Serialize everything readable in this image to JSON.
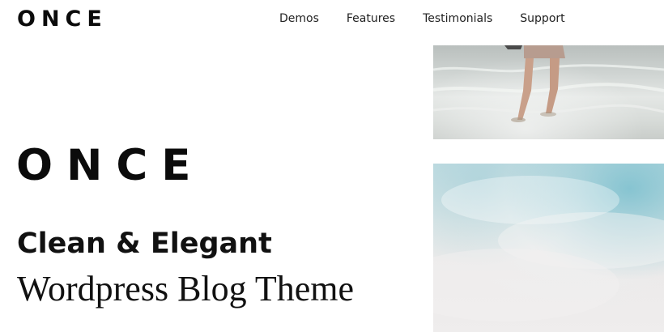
{
  "header": {
    "logo": "ONCE",
    "nav": [
      {
        "label": "Demos"
      },
      {
        "label": "Features"
      },
      {
        "label": "Testimonials"
      },
      {
        "label": "Support"
      }
    ]
  },
  "hero": {
    "logo": "ONCE",
    "tagline_line1": "Clean & Elegant",
    "tagline_line2": "Wordpress Blog Theme"
  },
  "images": {
    "top_photo": "beach-walk-photo",
    "bottom_photo": "sky-clouds-photo"
  }
}
